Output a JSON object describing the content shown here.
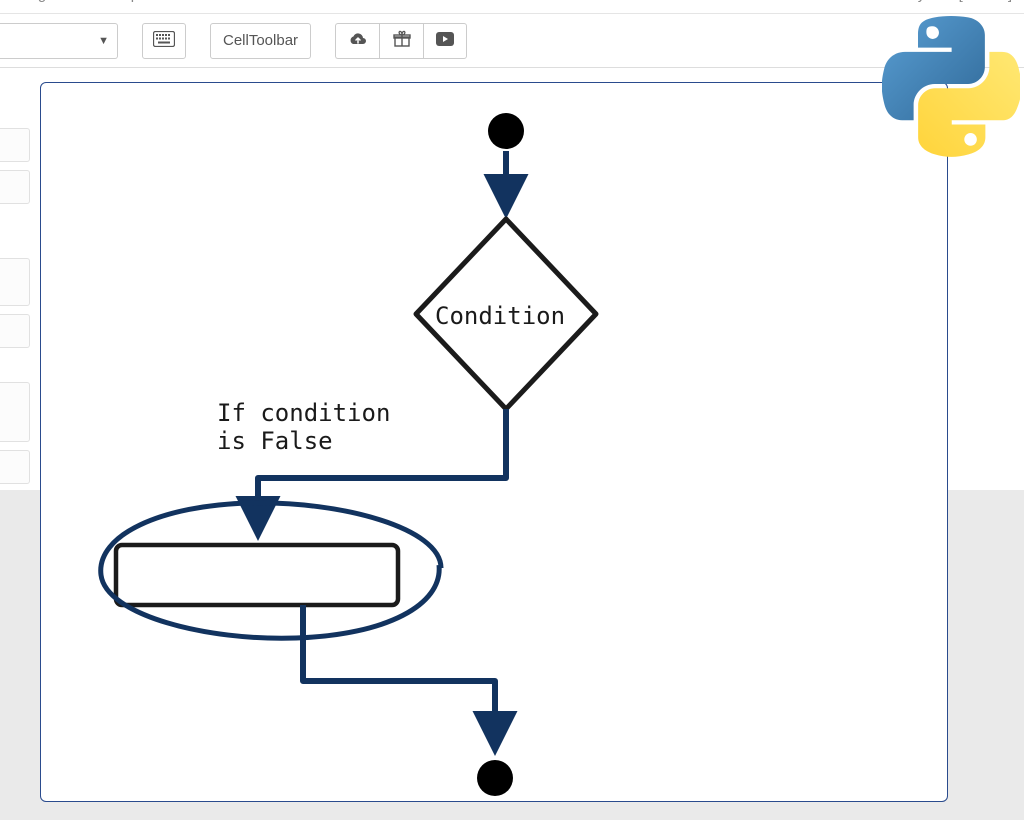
{
  "menubar": {
    "items": [
      "Widgets",
      "Help"
    ],
    "kernel_label": "Python [default]"
  },
  "toolbar": {
    "select_caret": "▼",
    "cell_toolbar_label": "CellToolbar",
    "icons": {
      "keyboard": "keyboard-icon",
      "cloud_upload": "cloud-upload-icon",
      "gift": "gift-icon",
      "youtube": "youtube-icon"
    }
  },
  "flowchart": {
    "condition_label": "Condition",
    "false_label": "If condition\nis False"
  }
}
